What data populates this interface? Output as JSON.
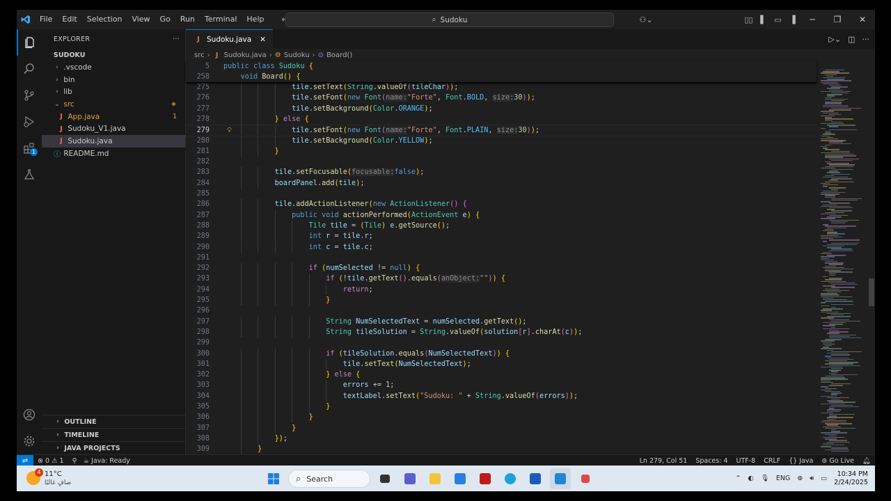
{
  "titlebar": {
    "menus": [
      "File",
      "Edit",
      "Selection",
      "View",
      "Go",
      "Run",
      "Terminal",
      "Help"
    ],
    "search": "Sudoku"
  },
  "sidebar": {
    "header": "EXPLORER",
    "more": "···",
    "root": "SUDOKU",
    "items": [
      {
        "label": ".vscode",
        "kind": "folder"
      },
      {
        "label": "bin",
        "kind": "folder"
      },
      {
        "label": "lib",
        "kind": "folder"
      },
      {
        "label": "src",
        "kind": "folder-open"
      },
      {
        "label": "App.java",
        "kind": "java",
        "badge": "1"
      },
      {
        "label": "Sudoku_V1.java",
        "kind": "java"
      },
      {
        "label": "Sudoku.java",
        "kind": "java",
        "selected": true
      },
      {
        "label": "README.md",
        "kind": "info"
      }
    ],
    "sections": [
      "OUTLINE",
      "TIMELINE",
      "JAVA PROJECTS"
    ]
  },
  "editor": {
    "tab": "Sudoku.java",
    "breadcrumb": [
      "src",
      "Sudoku.java",
      "Sudoku",
      "Board()"
    ],
    "sticky": [
      {
        "n": "5",
        "t": "public class Sudoku {"
      },
      {
        "n": "258",
        "t": "    void Board() {"
      }
    ],
    "lines": [
      {
        "n": "275",
        "t": "                tile.setText(String.valueOf(tileChar));"
      },
      {
        "n": "276",
        "t": "                tile.setFont(new Font(name:\"Forte\", Font.BOLD, size:30));"
      },
      {
        "n": "277",
        "t": "                tile.setBackground(Color.ORANGE);"
      },
      {
        "n": "278",
        "t": "            } else {"
      },
      {
        "n": "279",
        "t": "                tile.setFont(new Font(name:\"Forte\", Font.PLAIN, size:30));"
      },
      {
        "n": "280",
        "t": "                tile.setBackground(Color.YELLOW);"
      },
      {
        "n": "281",
        "t": "            }"
      },
      {
        "n": "282",
        "t": ""
      },
      {
        "n": "283",
        "t": "            tile.setFocusable(focusable:false);"
      },
      {
        "n": "284",
        "t": "            boardPanel.add(tile);"
      },
      {
        "n": "285",
        "t": ""
      },
      {
        "n": "286",
        "t": "            tile.addActionListener(new ActionListener() {"
      },
      {
        "n": "287",
        "t": "                public void actionPerformed(ActionEvent e) {"
      },
      {
        "n": "288",
        "t": "                    Tile tile = (Tile) e.getSource();"
      },
      {
        "n": "289",
        "t": "                    int r = tile.r;"
      },
      {
        "n": "290",
        "t": "                    int c = tile.c;"
      },
      {
        "n": "291",
        "t": ""
      },
      {
        "n": "292",
        "t": "                    if (numSelected != null) {"
      },
      {
        "n": "293",
        "t": "                        if (!tile.getText().equals(anObject:\"\")) {"
      },
      {
        "n": "294",
        "t": "                            return;"
      },
      {
        "n": "295",
        "t": "                        }"
      },
      {
        "n": "296",
        "t": ""
      },
      {
        "n": "297",
        "t": "                        String NumSelectedText = numSelected.getText();"
      },
      {
        "n": "298",
        "t": "                        String tileSolution = String.valueOf(solution[r].charAt(c));"
      },
      {
        "n": "299",
        "t": ""
      },
      {
        "n": "300",
        "t": "                        if (tileSolution.equals(NumSelectedText)) {"
      },
      {
        "n": "301",
        "t": "                            tile.setText(NumSelectedText);"
      },
      {
        "n": "302",
        "t": "                        } else {"
      },
      {
        "n": "303",
        "t": "                            errors += 1;"
      },
      {
        "n": "304",
        "t": "                            textLabel.setText(\"Sudoku: \" + String.valueOf(errors));"
      },
      {
        "n": "305",
        "t": "                        }"
      },
      {
        "n": "306",
        "t": "                    }"
      },
      {
        "n": "307",
        "t": "                }"
      },
      {
        "n": "308",
        "t": "            });"
      },
      {
        "n": "309",
        "t": "        }"
      }
    ],
    "current_line": "279"
  },
  "statusbar": {
    "problems_errors": "0",
    "problems_warnings": "1",
    "java_status": "Java: Ready",
    "position": "Ln 279, Col 51",
    "spaces": "Spaces: 4",
    "encoding": "UTF-8",
    "eol": "CRLF",
    "language": "Java",
    "golive": "Go Live"
  },
  "taskbar": {
    "temp": "11°C",
    "condition": "صافٍ غالبًا",
    "weather_badge": "4",
    "search": "Search",
    "lang": "ENG",
    "time": "10:34 PM",
    "date": "2/24/2025"
  }
}
